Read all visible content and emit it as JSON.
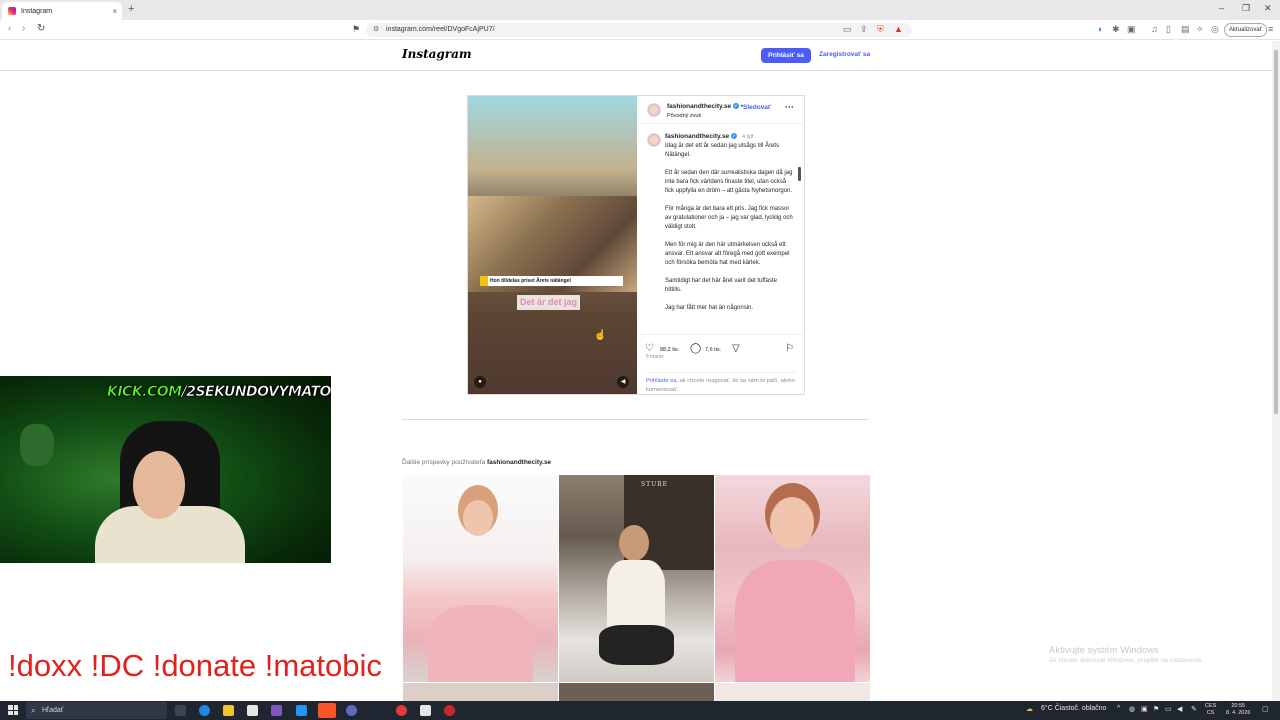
{
  "browser": {
    "tab_title": "Instagram",
    "url": "instagram.com/reel/DVgoFcAjPU7/",
    "update_label": "Aktualizovať",
    "new_tab_icon": "+",
    "close_tab_icon": "×"
  },
  "header": {
    "logo": "Instagram",
    "login_label": "Prihlásiť sa",
    "signup_label": "Zaregistrovať sa"
  },
  "post": {
    "username": "fashionandthecity.se",
    "follow_label": "Sledovať",
    "separator": "•",
    "audio_label": "Pôvodný zvuk",
    "video_caption_bar": "Hon tilldelas priset Årets nätängel",
    "video_subtitle": "Det är det jag",
    "caption_time": "4 týž.",
    "caption_paragraphs": [
      "Idag är det ett år sedan jag utsågs till Årets Nätängel.",
      "Ett år sedan den där surrealistiska dagen då jag inte bara fick världens finaste titel, utan också fick uppfylla en dröm – att gästa Nyhetsmorgon.",
      "För många är det bara ett pris. Jag fick massor av gratulationer och ja – jag var glad, lycklig och väldigt stolt.",
      "Men för mig är den här utmärkelsen också ett ansvar. Ett ansvar att föregå med gott exempel och försöka bemöta hat med kärlek.",
      "Samtidigt har det här året varit det tuffaste hittills.",
      "Jag har fått mer hat än någonsin."
    ],
    "likes": "88,2 tis.",
    "comments": "7,6 tis.",
    "date": "5 marec",
    "login_hint_link": "Prihláste sa,",
    "login_hint_rest": " ak chcete reagovať, že sa vám to páči, alebo komentovať."
  },
  "more_posts": {
    "prefix": "Ďalšie príspevky používateľa ",
    "username": "fashionandthecity.se"
  },
  "stream": {
    "kick_prefix": "KICK.COM",
    "kick_suffix": "/2SEKUNDOVYMATO",
    "commands": "!doxx  !DC !donate !matobic"
  },
  "windows": {
    "activation_title": "Aktivujte systém Windows",
    "activation_sub": "Ak chcete aktivovať Windows, prejdite na nastavenia.",
    "search_placeholder": "Hľadať",
    "weather": "6°C  Čiastoč. oblačno",
    "lang_line1": "CES",
    "lang_line2": "CS",
    "time": "20:55",
    "date": "8. 4. 2026"
  }
}
